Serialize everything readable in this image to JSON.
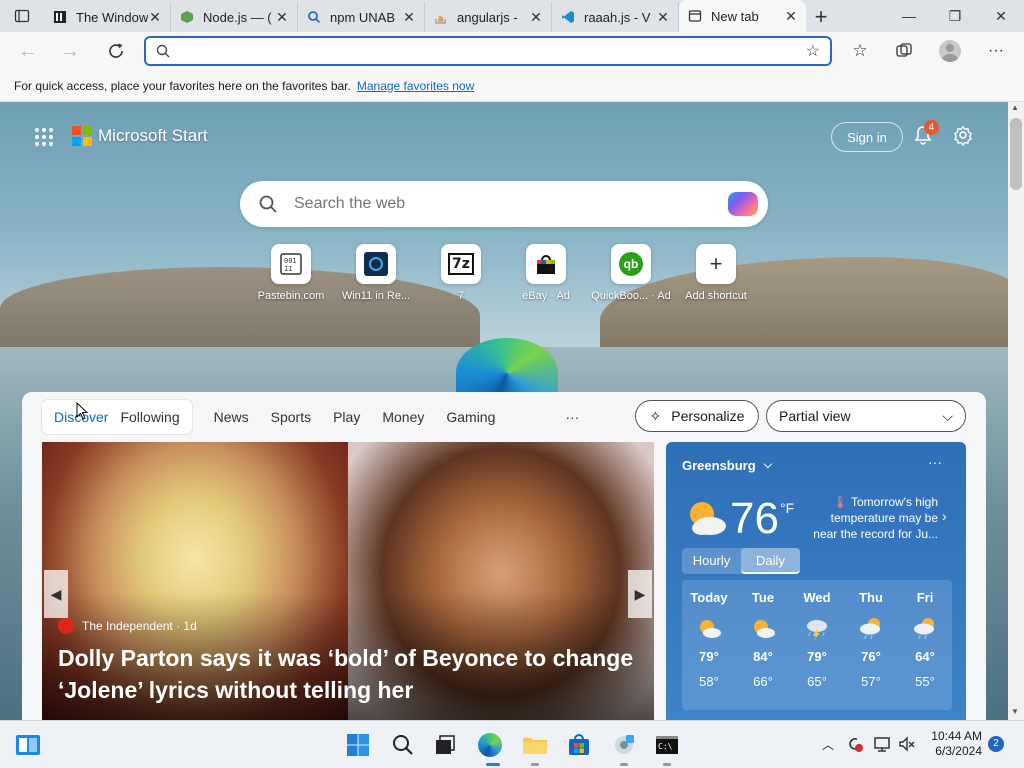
{
  "tabs": [
    {
      "title": "The Windows",
      "active": false
    },
    {
      "title": "Node.js — (",
      "active": false
    },
    {
      "title": "npm UNAB",
      "active": false
    },
    {
      "title": "angularjs -",
      "active": false
    },
    {
      "title": "raaah.js - V",
      "active": false
    },
    {
      "title": "New tab",
      "active": true
    }
  ],
  "address": {
    "value": "",
    "placeholder": ""
  },
  "favbar": {
    "text": "For quick access, place your favorites here on the favorites bar.",
    "link": "Manage favorites now"
  },
  "start": {
    "brand": "Microsoft Start",
    "sign_in": "Sign in",
    "notifications": "4",
    "search_placeholder": "Search the web",
    "shortcuts": [
      {
        "label": "Pastebin.com"
      },
      {
        "label": "Win11 in Re..."
      },
      {
        "label": "7"
      },
      {
        "label": "eBay · Ad"
      },
      {
        "label": "QuickBoo... · Ad"
      },
      {
        "label": "Add shortcut"
      }
    ]
  },
  "feed": {
    "tabs_pill": [
      "Discover",
      "Following"
    ],
    "tabs": [
      "News",
      "Sports",
      "Play",
      "Money",
      "Gaming"
    ],
    "more": "···",
    "personalize": "Personalize",
    "view": "Partial view",
    "hero": {
      "source": "The Independent · 1d",
      "headline": "Dolly Parton says it was ‘bold’ of Beyonce to change ‘Jolene’ lyrics without telling her"
    }
  },
  "weather": {
    "location": "Greensburg",
    "temp": "76",
    "unit": "°F",
    "alert": "Tomorrow's high temperature may be near the record for Ju...",
    "toggle": [
      "Hourly",
      "Daily"
    ],
    "days": [
      {
        "day": "Today",
        "hi": "79°",
        "lo": "58°",
        "icon": "partly-sunny"
      },
      {
        "day": "Tue",
        "hi": "84°",
        "lo": "66°",
        "icon": "partly-sunny"
      },
      {
        "day": "Wed",
        "hi": "79°",
        "lo": "65°",
        "icon": "thunder-rain"
      },
      {
        "day": "Thu",
        "hi": "76°",
        "lo": "57°",
        "icon": "partly-rain"
      },
      {
        "day": "Fri",
        "hi": "64°",
        "lo": "55°",
        "icon": "partly-rain"
      }
    ]
  },
  "clock": {
    "time": "10:44 AM",
    "date": "6/3/2024"
  },
  "tray_badge": "2"
}
